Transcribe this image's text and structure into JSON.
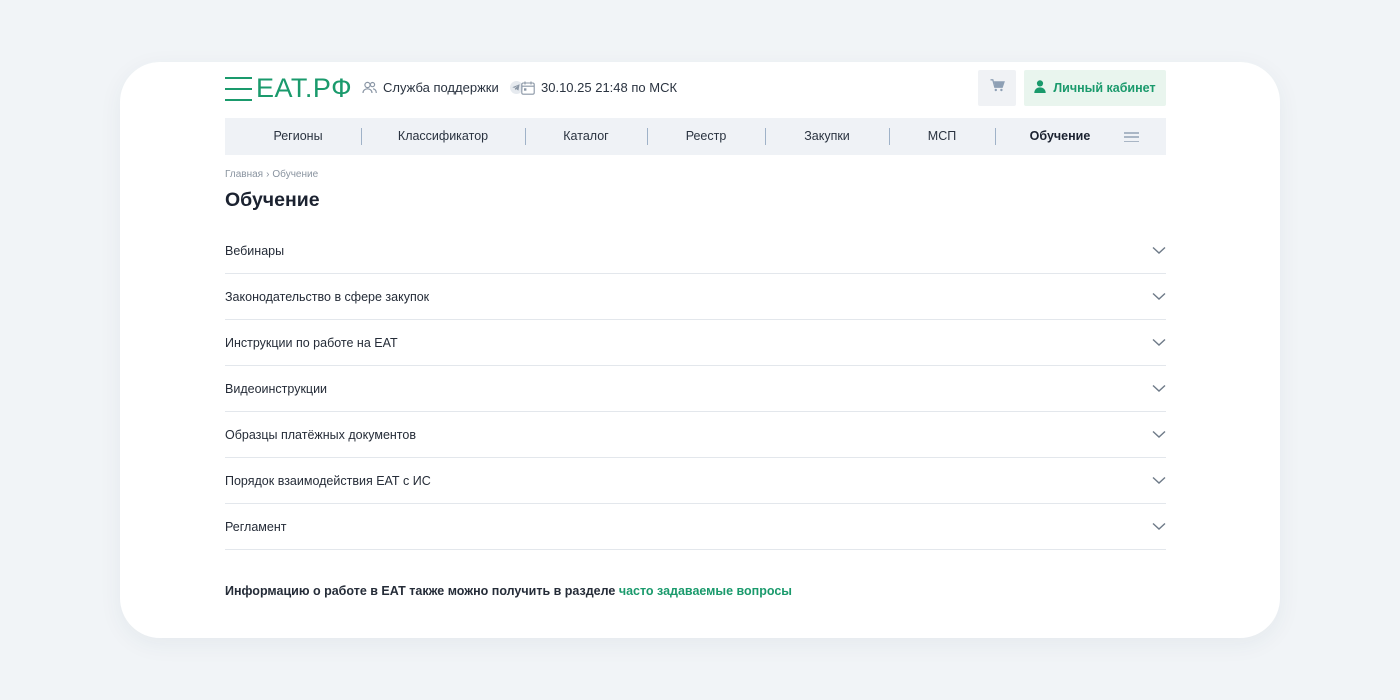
{
  "header": {
    "logo_text": "ЕАТ.РФ",
    "support_label": "Служба поддержки",
    "datetime": "30.10.25 21:48 по МСК",
    "account_label": "Личный кабинет"
  },
  "nav": {
    "items": [
      {
        "label": "Регионы"
      },
      {
        "label": "Классификатор"
      },
      {
        "label": "Каталог"
      },
      {
        "label": "Реестр"
      },
      {
        "label": "Закупки"
      },
      {
        "label": "МСП"
      },
      {
        "label": "Обучение"
      }
    ],
    "active": "Обучение"
  },
  "breadcrumb": {
    "home": "Главная",
    "separator": "›",
    "current": "Обучение"
  },
  "page": {
    "title": "Обучение"
  },
  "accordion": {
    "items": [
      {
        "label": "Вебинары"
      },
      {
        "label": "Законодательство в сфере закупок"
      },
      {
        "label": "Инструкции по работе на ЕАТ"
      },
      {
        "label": "Видеоинструкции"
      },
      {
        "label": "Образцы платёжных документов"
      },
      {
        "label": "Порядок взаимодействия ЕАТ с ИС"
      },
      {
        "label": "Регламент"
      }
    ]
  },
  "footer": {
    "note_text": "Информацию о работе в ЕАТ также можно получить в разделе ",
    "link_text": "часто задаваемые вопросы"
  },
  "colors": {
    "brand": "#1a9a6c",
    "nav_bg": "#eff2f6",
    "page_bg": "#f1f4f7"
  },
  "icons": {
    "support": "users-icon",
    "telegram": "telegram-icon",
    "calendar": "calendar-icon",
    "cart": "cart-icon",
    "account": "user-icon",
    "menu": "menu-icon",
    "chevron": "chevron-down-icon"
  }
}
